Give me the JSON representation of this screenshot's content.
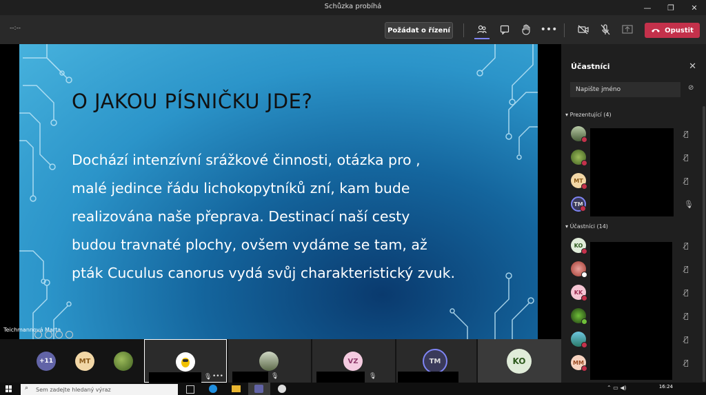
{
  "window": {
    "title": "Schůzka probíhá"
  },
  "toolbar": {
    "timer": "--:--",
    "request_control_label": "Požádat o řízení",
    "leave_label": "Opustit"
  },
  "slide": {
    "title": "O JAKOU PÍSNIČKU JDE?",
    "lines": [
      "Dochází  intenzívní srážkové činnosti, otázka pro     ,",
      "malé jedince řádu lichokopytníků zní, kam bude",
      "realizována naše přeprava. Destinací naší cesty",
      "budou travnaté plochy, ovšem vydáme se tam, až",
      "pták Cuculus canorus vydá svůj charakteristický zvuk."
    ]
  },
  "presenter_name": "Teichmannová Marta",
  "gallery": {
    "overflow_count": "+11",
    "avatars": [
      "MT",
      "VZ",
      "TM",
      "KO"
    ]
  },
  "panel": {
    "title": "Účastníci",
    "search_placeholder": "Napište jméno",
    "presenters_header": "Prezentující (4)",
    "presenter_avatars": [
      "",
      "",
      "MT",
      "TM"
    ],
    "attendees_header": "Účastníci (14)",
    "attendee_avatars": [
      "KO",
      "",
      "KK",
      "",
      "",
      "MM"
    ]
  },
  "taskbar": {
    "search_placeholder": "Sem zadejte hledaný výraz",
    "time": "16:24"
  },
  "colors": {
    "leave": "#c4314b",
    "accent": "#6264a7"
  }
}
